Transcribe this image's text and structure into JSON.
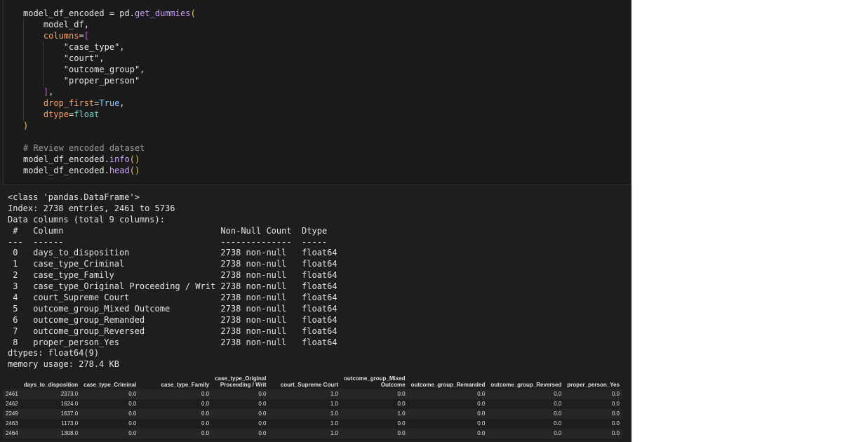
{
  "code": {
    "lines": [
      [
        [
          "c-var",
          "model_df_encoded"
        ],
        [
          "c-op",
          " = "
        ],
        [
          "c-mod",
          "pd"
        ],
        [
          "c-op",
          "."
        ],
        [
          "c-fn",
          "get_dummies"
        ],
        [
          "b1",
          "("
        ]
      ],
      [
        [
          "c-op",
          "    "
        ],
        [
          "c-var",
          "model_df"
        ],
        [
          "c-op",
          ","
        ]
      ],
      [
        [
          "c-op",
          "    "
        ],
        [
          "c-kw",
          "columns"
        ],
        [
          "c-op",
          "="
        ],
        [
          "b2",
          "["
        ]
      ],
      [
        [
          "c-op",
          "        "
        ],
        [
          "c-str",
          "\"case_type\""
        ],
        [
          "c-op",
          ","
        ]
      ],
      [
        [
          "c-op",
          "        "
        ],
        [
          "c-str",
          "\"court\""
        ],
        [
          "c-op",
          ","
        ]
      ],
      [
        [
          "c-op",
          "        "
        ],
        [
          "c-str",
          "\"outcome_group\""
        ],
        [
          "c-op",
          ","
        ]
      ],
      [
        [
          "c-op",
          "        "
        ],
        [
          "c-str",
          "\"proper_person\""
        ]
      ],
      [
        [
          "c-op",
          "    "
        ],
        [
          "b2",
          "]"
        ],
        [
          "c-op",
          ","
        ]
      ],
      [
        [
          "c-op",
          "    "
        ],
        [
          "c-kw",
          "drop_first"
        ],
        [
          "c-op",
          "="
        ],
        [
          "c-const",
          "True"
        ],
        [
          "c-op",
          ","
        ]
      ],
      [
        [
          "c-op",
          "    "
        ],
        [
          "c-kw",
          "dtype"
        ],
        [
          "c-op",
          "="
        ],
        [
          "c-bi",
          "float"
        ]
      ],
      [
        [
          "b1",
          ")"
        ]
      ],
      [
        [
          "c-op",
          ""
        ]
      ],
      [
        [
          "c-comment",
          "# Review encoded dataset"
        ]
      ],
      [
        [
          "c-var",
          "model_df_encoded"
        ],
        [
          "c-op",
          "."
        ],
        [
          "c-fn",
          "info"
        ],
        [
          "b1",
          "()"
        ]
      ],
      [
        [
          "c-var",
          "model_df_encoded"
        ],
        [
          "c-op",
          "."
        ],
        [
          "c-fn",
          "head"
        ],
        [
          "b1",
          "()"
        ]
      ]
    ]
  },
  "output": {
    "lines": [
      "<class 'pandas.DataFrame'>",
      "Index: 2738 entries, 2461 to 5736",
      "Data columns (total 9 columns):",
      " #   Column                               Non-Null Count  Dtype",
      "---  ------                               --------------  -----",
      " 0   days_to_disposition                  2738 non-null   float64",
      " 1   case_type_Criminal                   2738 non-null   float64",
      " 2   case_type_Family                     2738 non-null   float64",
      " 3   case_type_Original Proceeding / Writ 2738 non-null   float64",
      " 4   court_Supreme Court                  2738 non-null   float64",
      " 5   outcome_group_Mixed Outcome          2738 non-null   float64",
      " 6   outcome_group_Remanded               2738 non-null   float64",
      " 7   outcome_group_Reversed               2738 non-null   float64",
      " 8   proper_person_Yes                    2738 non-null   float64",
      "dtypes: float64(9)",
      "memory usage: 278.4 KB"
    ]
  },
  "table": {
    "headers": [
      "",
      "days_to_disposition",
      "case_type_Criminal",
      "case_type_Family",
      "case_type_Original Proceeding / Writ",
      "court_Supreme Court",
      "outcome_group_Mixed Outcome",
      "outcome_group_Remanded",
      "outcome_group_Reversed",
      "proper_person_Yes"
    ],
    "rows": [
      [
        "2461",
        "2373.0",
        "0.0",
        "0.0",
        "0.0",
        "1.0",
        "0.0",
        "0.0",
        "0.0",
        "0.0"
      ],
      [
        "2462",
        "1624.0",
        "0.0",
        "0.0",
        "0.0",
        "1.0",
        "0.0",
        "0.0",
        "0.0",
        "0.0"
      ],
      [
        "2249",
        "1637.0",
        "0.0",
        "0.0",
        "0.0",
        "1.0",
        "1.0",
        "0.0",
        "0.0",
        "0.0"
      ],
      [
        "2463",
        "1173.0",
        "0.0",
        "0.0",
        "0.0",
        "1.0",
        "0.0",
        "0.0",
        "0.0",
        "0.0"
      ],
      [
        "2464",
        "1308.0",
        "0.0",
        "0.0",
        "0.0",
        "1.0",
        "0.0",
        "0.0",
        "0.0",
        "0.0"
      ]
    ]
  },
  "colors": {
    "background": "#1e1e1e",
    "code_cell": "#1b1b1b",
    "right_panel": "#ffffff",
    "function": "#c9a0ff",
    "keyword_arg": "#ff9f5a",
    "constant": "#7ec7ff",
    "builtin": "#6fd6c6",
    "comment": "#9a9a9a",
    "bracket_outer": "#f2c94c",
    "bracket_inner": "#c95cd6"
  }
}
